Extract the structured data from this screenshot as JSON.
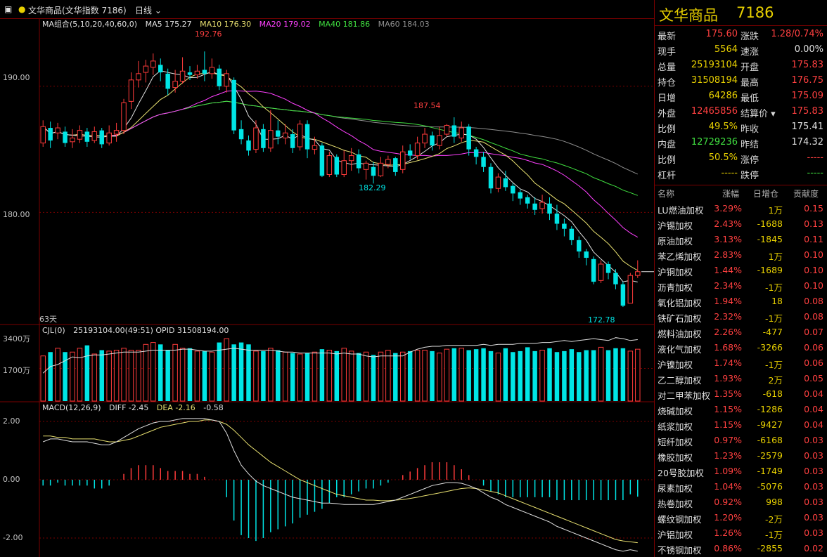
{
  "topbar": {
    "menu_icon": "menu-icon",
    "title": "文华商品(文华指数  7186)",
    "period": "日线"
  },
  "colors": {
    "up": "#ff3b3b",
    "down": "#00e5e5",
    "ma5": "#e0e0e0",
    "ma10": "#e8e070",
    "ma20": "#ff40ff",
    "ma40": "#40e040",
    "ma60": "#909090",
    "grid": "#7a0000"
  },
  "main_legend": {
    "group": "MA组合(5,10,20,40,60,0)",
    "ma5": "MA5 175.27",
    "ma10": "MA10 176.30",
    "ma20": "MA20 179.02",
    "ma40": "MA40 181.86",
    "ma60": "MA60 184.03"
  },
  "vol_legend": {
    "name": "CJL(0)",
    "values": "25193104.00(49:51)  OPID 31508194.00"
  },
  "macd_legend": {
    "name": "MACD(12,26,9)",
    "diff": "DIFF -2.45",
    "dea": "DEA -2.16",
    "macd": "-0.58"
  },
  "axes": {
    "price_ticks": [
      "190.00",
      "180.00"
    ],
    "vol_ticks": [
      "3400万",
      "1700万"
    ],
    "macd_ticks": [
      "2.00",
      "0.00",
      "-2.00"
    ],
    "days_label": "63天"
  },
  "annotations": {
    "high1": "192.76",
    "high2": "187.54",
    "low1": "182.29",
    "low2": "172.78"
  },
  "chart_data": {
    "type": "candlestick",
    "price_range": [
      171.5,
      194.5
    ],
    "vol_range": [
      0,
      3400
    ],
    "macd_range": [
      -2.5,
      2.5
    ],
    "candles": [
      [
        185.5,
        186.8,
        185.2,
        187.3
      ],
      [
        186.7,
        185.7,
        185.1,
        187.2
      ],
      [
        186.3,
        186.7,
        185.8,
        187.1
      ],
      [
        186.4,
        185.5,
        185.2,
        186.8
      ],
      [
        185.6,
        185.9,
        185.1,
        186.6
      ],
      [
        185.8,
        186.5,
        185.5,
        186.9
      ],
      [
        186.4,
        185.6,
        185.2,
        186.7
      ],
      [
        185.7,
        186.4,
        185.5,
        186.8
      ],
      [
        186.5,
        185.4,
        185.1,
        186.7
      ],
      [
        185.5,
        186.3,
        185.3,
        186.9
      ],
      [
        186.2,
        186.5,
        185.6,
        187.1
      ],
      [
        186.5,
        188.7,
        186.2,
        189.0
      ],
      [
        188.8,
        190.5,
        188.2,
        191.1
      ],
      [
        190.5,
        191.0,
        189.9,
        192.0
      ],
      [
        191.1,
        191.6,
        190.3,
        192.1
      ],
      [
        191.5,
        192.0,
        190.9,
        192.6
      ],
      [
        191.7,
        191.1,
        190.4,
        192.2
      ],
      [
        191.0,
        189.8,
        189.3,
        191.4
      ],
      [
        189.9,
        190.4,
        189.5,
        191.3
      ],
      [
        190.4,
        191.2,
        190.2,
        192.3
      ],
      [
        191.1,
        190.9,
        190.5,
        191.6
      ],
      [
        190.9,
        191.2,
        190.6,
        191.7
      ],
      [
        191.3,
        191.0,
        190.4,
        192.76
      ],
      [
        191.0,
        191.5,
        190.6,
        192.2
      ],
      [
        191.4,
        190.0,
        189.7,
        191.7
      ],
      [
        190.0,
        191.0,
        189.5,
        191.3
      ],
      [
        190.5,
        186.5,
        186.2,
        190.7
      ],
      [
        186.6,
        185.8,
        185.4,
        187.3
      ],
      [
        185.7,
        184.9,
        184.5,
        186.1
      ],
      [
        185.0,
        186.7,
        184.7,
        187.3
      ],
      [
        186.6,
        185.1,
        184.8,
        187.0
      ],
      [
        185.1,
        186.5,
        184.8,
        188.1
      ],
      [
        186.5,
        186.0,
        185.4,
        187.3
      ],
      [
        185.9,
        186.3,
        185.4,
        187.0
      ],
      [
        186.2,
        185.1,
        184.7,
        186.6
      ],
      [
        185.2,
        187.0,
        184.9,
        187.3
      ],
      [
        187.0,
        185.0,
        184.3,
        187.3
      ],
      [
        185.0,
        185.3,
        184.6,
        186.0
      ],
      [
        185.3,
        182.9,
        182.8,
        185.5
      ],
      [
        183.0,
        184.5,
        182.8,
        184.8
      ],
      [
        184.4,
        183.0,
        182.8,
        184.6
      ],
      [
        183.0,
        184.1,
        182.8,
        184.9
      ],
      [
        184.1,
        184.5,
        183.3,
        185.1
      ],
      [
        184.6,
        183.5,
        183.1,
        185.0
      ],
      [
        183.4,
        183.9,
        182.6,
        184.1
      ],
      [
        183.6,
        182.9,
        182.29,
        184.0
      ],
      [
        182.9,
        183.9,
        182.8,
        184.4
      ],
      [
        183.8,
        184.2,
        183.5,
        184.5
      ],
      [
        184.3,
        183.2,
        182.9,
        184.4
      ],
      [
        183.4,
        184.8,
        183.1,
        185.3
      ],
      [
        184.9,
        184.5,
        184.2,
        185.4
      ],
      [
        184.5,
        185.5,
        184.2,
        186.0
      ],
      [
        185.5,
        186.2,
        185.1,
        186.7
      ],
      [
        186.1,
        185.3,
        184.9,
        186.4
      ],
      [
        185.3,
        186.1,
        185.0,
        186.8
      ],
      [
        186.2,
        186.9,
        186.0,
        187.0
      ],
      [
        186.9,
        186.0,
        185.5,
        187.54
      ],
      [
        185.9,
        186.7,
        185.6,
        187.2
      ],
      [
        186.8,
        185.0,
        184.5,
        187.0
      ],
      [
        185.0,
        184.4,
        183.8,
        185.2
      ],
      [
        184.4,
        183.6,
        183.2,
        184.8
      ],
      [
        183.6,
        181.9,
        181.5,
        183.9
      ],
      [
        181.9,
        182.8,
        181.6,
        183.1
      ],
      [
        182.7,
        182.0,
        181.7,
        183.3
      ],
      [
        182.1,
        181.5,
        180.9,
        182.3
      ],
      [
        181.6,
        181.1,
        180.6,
        181.8
      ],
      [
        181.2,
        180.7,
        180.3,
        181.4
      ],
      [
        180.7,
        180.2,
        179.8,
        181.2
      ],
      [
        180.3,
        180.8,
        179.9,
        181.4
      ],
      [
        180.7,
        179.9,
        179.4,
        181.2
      ],
      [
        179.9,
        179.1,
        178.6,
        180.6
      ],
      [
        179.1,
        178.7,
        178.1,
        179.5
      ],
      [
        178.7,
        177.8,
        177.4,
        178.9
      ],
      [
        177.8,
        176.9,
        176.4,
        178.1
      ],
      [
        176.9,
        176.4,
        175.8,
        177.1
      ],
      [
        176.3,
        174.5,
        174.3,
        176.5
      ],
      [
        174.6,
        175.9,
        174.4,
        176.2
      ],
      [
        175.9,
        175.2,
        174.7,
        176.1
      ],
      [
        175.2,
        174.3,
        173.9,
        175.5
      ],
      [
        174.3,
        172.6,
        172.5,
        174.5
      ],
      [
        172.8,
        175.0,
        172.78,
        175.2
      ],
      [
        175.0,
        175.3,
        174.8,
        176.2
      ]
    ],
    "volumes": [
      2350,
      2550,
      2750,
      2550,
      2550,
      2750,
      2900,
      2450,
      2650,
      2600,
      2650,
      2750,
      2650,
      2650,
      2950,
      3050,
      2950,
      2650,
      2950,
      2750,
      2750,
      2600,
      2600,
      2550,
      3050,
      3250,
      2950,
      3050,
      2950,
      2600,
      2600,
      2750,
      2650,
      2550,
      2500,
      2450,
      2500,
      2550,
      2700,
      2650,
      2600,
      2750,
      2600,
      2500,
      2550,
      2400,
      2550,
      2650,
      2500,
      2550,
      2600,
      2650,
      2650,
      2600,
      2500,
      2700,
      2750,
      2750,
      2650,
      2700,
      2750,
      2600,
      2500,
      2750,
      2550,
      2600,
      2800,
      2600,
      2650,
      2750,
      2550,
      2600,
      2700,
      2550,
      2650,
      2650,
      2800,
      2650,
      2750,
      2750,
      2600,
      2700
    ],
    "vol_ma": [
      1450,
      1800,
      1900,
      2100,
      2300,
      2250,
      2350,
      2400,
      2400,
      2450,
      2500,
      2550,
      2550,
      2550,
      2600,
      2650,
      2650,
      2650,
      2650,
      2700,
      2700,
      2650,
      2600,
      2600,
      2650,
      2700,
      2750,
      2700,
      2650,
      2650,
      2650,
      2650,
      2600,
      2550,
      2550,
      2500,
      2500,
      2500,
      2500,
      2500,
      2450,
      2500,
      2450,
      2450,
      2350,
      2300,
      2350,
      2350,
      2350,
      2350,
      2550,
      2700,
      2800,
      2850,
      2850,
      2900,
      2900,
      2900,
      2900,
      2900,
      2950,
      2900,
      2950,
      2950,
      2950,
      3000,
      3000,
      3000,
      3050,
      3050,
      3100,
      3150,
      3100,
      3150,
      3200,
      3250,
      3200,
      3150,
      3300,
      3250,
      3150,
      3200
    ],
    "diff": [
      1.3,
      1.4,
      1.4,
      1.35,
      1.3,
      1.3,
      1.3,
      1.25,
      1.2,
      1.2,
      1.3,
      1.45,
      1.6,
      1.75,
      1.85,
      1.95,
      2.0,
      2.0,
      2.05,
      2.1,
      2.1,
      2.1,
      2.1,
      2.05,
      2.0,
      1.6,
      1.0,
      0.5,
      0.2,
      -0.05,
      -0.2,
      -0.3,
      -0.4,
      -0.5,
      -0.6,
      -0.65,
      -0.7,
      -0.75,
      -0.8,
      -0.8,
      -0.82,
      -0.85,
      -0.85,
      -0.85,
      -0.85,
      -0.85,
      -0.8,
      -0.75,
      -0.7,
      -0.6,
      -0.5,
      -0.4,
      -0.3,
      -0.2,
      -0.15,
      -0.1,
      -0.1,
      -0.12,
      -0.2,
      -0.3,
      -0.45,
      -0.6,
      -0.7,
      -0.85,
      -0.95,
      -1.05,
      -1.15,
      -1.25,
      -1.35,
      -1.45,
      -1.6,
      -1.7,
      -1.8,
      -1.9,
      -2.0,
      -2.1,
      -2.2,
      -2.3,
      -2.4,
      -2.45,
      -2.4,
      -2.45
    ],
    "dea": [
      1.5,
      1.5,
      1.45,
      1.45,
      1.4,
      1.4,
      1.4,
      1.4,
      1.35,
      1.3,
      1.3,
      1.35,
      1.4,
      1.5,
      1.6,
      1.7,
      1.8,
      1.85,
      1.9,
      1.95,
      2.0,
      2.0,
      2.05,
      2.05,
      2.0,
      1.9,
      1.7,
      1.45,
      1.2,
      1.0,
      0.8,
      0.6,
      0.45,
      0.3,
      0.15,
      0.0,
      -0.1,
      -0.2,
      -0.3,
      -0.4,
      -0.5,
      -0.55,
      -0.6,
      -0.65,
      -0.7,
      -0.7,
      -0.72,
      -0.72,
      -0.7,
      -0.68,
      -0.64,
      -0.6,
      -0.55,
      -0.5,
      -0.45,
      -0.4,
      -0.35,
      -0.3,
      -0.28,
      -0.3,
      -0.35,
      -0.4,
      -0.45,
      -0.55,
      -0.65,
      -0.75,
      -0.85,
      -0.95,
      -1.05,
      -1.15,
      -1.25,
      -1.35,
      -1.45,
      -1.55,
      -1.65,
      -1.75,
      -1.85,
      -1.95,
      -2.05,
      -2.1,
      -2.13,
      -2.16
    ],
    "macd_bars": [
      -0.2,
      -0.2,
      -0.1,
      -0.2,
      -0.2,
      -0.2,
      -0.2,
      -0.3,
      -0.3,
      -0.2,
      0.0,
      0.2,
      0.4,
      0.5,
      0.5,
      0.5,
      0.4,
      0.3,
      0.3,
      0.3,
      0.2,
      0.2,
      0.1,
      0.0,
      0.0,
      -0.6,
      -1.4,
      -1.9,
      -2.0,
      -2.1,
      -2.0,
      -1.8,
      -1.7,
      -1.6,
      -1.5,
      -1.3,
      -1.2,
      -1.1,
      -1.0,
      -0.8,
      -0.6,
      -0.6,
      -0.5,
      -0.4,
      -0.3,
      -0.3,
      -0.2,
      -0.1,
      0.0,
      0.16,
      0.28,
      0.4,
      0.5,
      0.6,
      0.6,
      0.6,
      0.5,
      0.36,
      0.16,
      0.0,
      -0.2,
      -0.4,
      -0.5,
      -0.6,
      -0.6,
      -0.6,
      -0.6,
      -0.6,
      -0.6,
      -0.6,
      -0.7,
      -0.7,
      -0.7,
      -0.7,
      -0.7,
      -0.7,
      -0.7,
      -0.7,
      -0.7,
      -0.7,
      -0.5,
      -0.58
    ]
  },
  "panel": {
    "title_name": "文华商品",
    "title_code": "7186",
    "quote_rows": [
      {
        "l1": "最新",
        "v1": "175.60",
        "c1": "#ff4040",
        "l2": "涨跌",
        "v2": "1.28/0.74%",
        "c2": "#ff4040"
      },
      {
        "l1": "现手",
        "v1": "5564",
        "c1": "#e8d000",
        "l2": "速涨",
        "v2": "0.00%",
        "c2": "#e0e0e0"
      },
      {
        "l1": "总量",
        "v1": "25193104",
        "c1": "#e8d000",
        "l2": "开盘",
        "v2": "175.83",
        "c2": "#ff4040"
      },
      {
        "l1": "持仓",
        "v1": "31508194",
        "c1": "#e8d000",
        "l2": "最高",
        "v2": "176.75",
        "c2": "#ff4040"
      },
      {
        "l1": "日增",
        "v1": "64286",
        "c1": "#e8d000",
        "l2": "最低",
        "v2": "175.09",
        "c2": "#ff4040"
      },
      {
        "l1": "外盘",
        "v1": "12465856",
        "c1": "#ff4040",
        "l2": "结算价",
        "v2": "175.83",
        "c2": "#ff4040"
      },
      {
        "l1": "比例",
        "v1": "49.5%",
        "c1": "#e8d000",
        "l2": "昨收",
        "v2": "175.41",
        "c2": "#e0e0e0"
      },
      {
        "l1": "内盘",
        "v1": "12729236",
        "c1": "#40e040",
        "l2": "昨结",
        "v2": "174.32",
        "c2": "#e0e0e0"
      },
      {
        "l1": "比例",
        "v1": "50.5%",
        "c1": "#e8d000",
        "l2": "涨停",
        "v2": "-----",
        "c2": "#ff4040"
      },
      {
        "l1": "杠杆",
        "v1": "-----",
        "c1": "#e8d000",
        "l2": "跌停",
        "v2": "-----",
        "c2": "#40e040"
      }
    ],
    "list_header": [
      "名称",
      "涨幅",
      "日增仓",
      "贡献度"
    ],
    "list": [
      {
        "name": "LU燃油加权",
        "chg": "3.29%",
        "oi": "1万",
        "oi_color": "#e8d000",
        "contrib": "0.15"
      },
      {
        "name": "沪锡加权",
        "chg": "2.43%",
        "oi": "-1688",
        "oi_color": "#e8d000",
        "contrib": "0.13"
      },
      {
        "name": "原油加权",
        "chg": "3.13%",
        "oi": "-1845",
        "oi_color": "#e8d000",
        "contrib": "0.11"
      },
      {
        "name": "苯乙烯加权",
        "chg": "2.83%",
        "oi": "1万",
        "oi_color": "#e8d000",
        "contrib": "0.10"
      },
      {
        "name": "沪铜加权",
        "chg": "1.44%",
        "oi": "-1689",
        "oi_color": "#e8d000",
        "contrib": "0.10"
      },
      {
        "name": "沥青加权",
        "chg": "2.34%",
        "oi": "-1万",
        "oi_color": "#e8d000",
        "contrib": "0.10"
      },
      {
        "name": "氧化铝加权",
        "chg": "1.94%",
        "oi": "18",
        "oi_color": "#e8d000",
        "contrib": "0.08"
      },
      {
        "name": "铁矿石加权",
        "chg": "2.32%",
        "oi": "-1万",
        "oi_color": "#e8d000",
        "contrib": "0.08"
      },
      {
        "name": "燃料油加权",
        "chg": "2.26%",
        "oi": "-477",
        "oi_color": "#e8d000",
        "contrib": "0.07"
      },
      {
        "name": "液化气加权",
        "chg": "1.68%",
        "oi": "-3266",
        "oi_color": "#e8d000",
        "contrib": "0.06"
      },
      {
        "name": "沪镍加权",
        "chg": "1.74%",
        "oi": "-1万",
        "oi_color": "#e8d000",
        "contrib": "0.06"
      },
      {
        "name": "乙二醇加权",
        "chg": "1.93%",
        "oi": "2万",
        "oi_color": "#e8d000",
        "contrib": "0.05"
      },
      {
        "name": "对二甲苯加权",
        "chg": "1.35%",
        "oi": "-618",
        "oi_color": "#e8d000",
        "contrib": "0.04"
      },
      {
        "name": "烧碱加权",
        "chg": "1.15%",
        "oi": "-1286",
        "oi_color": "#e8d000",
        "contrib": "0.04"
      },
      {
        "name": "纸浆加权",
        "chg": "1.15%",
        "oi": "-9427",
        "oi_color": "#e8d000",
        "contrib": "0.04"
      },
      {
        "name": "短纤加权",
        "chg": "0.97%",
        "oi": "-6168",
        "oi_color": "#e8d000",
        "contrib": "0.03"
      },
      {
        "name": "橡胶加权",
        "chg": "1.23%",
        "oi": "-2579",
        "oi_color": "#e8d000",
        "contrib": "0.03"
      },
      {
        "name": "20号胶加权",
        "chg": "1.09%",
        "oi": "-1749",
        "oi_color": "#e8d000",
        "contrib": "0.03"
      },
      {
        "name": "尿素加权",
        "chg": "1.04%",
        "oi": "-5076",
        "oi_color": "#e8d000",
        "contrib": "0.03"
      },
      {
        "name": "热卷加权",
        "chg": "0.92%",
        "oi": "998",
        "oi_color": "#e8d000",
        "contrib": "0.03"
      },
      {
        "name": "螺纹钢加权",
        "chg": "1.20%",
        "oi": "-2万",
        "oi_color": "#e8d000",
        "contrib": "0.03"
      },
      {
        "name": "沪铝加权",
        "chg": "1.26%",
        "oi": "-1万",
        "oi_color": "#e8d000",
        "contrib": "0.03"
      },
      {
        "name": "不锈钢加权",
        "chg": "0.86%",
        "oi": "-2855",
        "oi_color": "#e8d000",
        "contrib": "0.02"
      }
    ]
  }
}
